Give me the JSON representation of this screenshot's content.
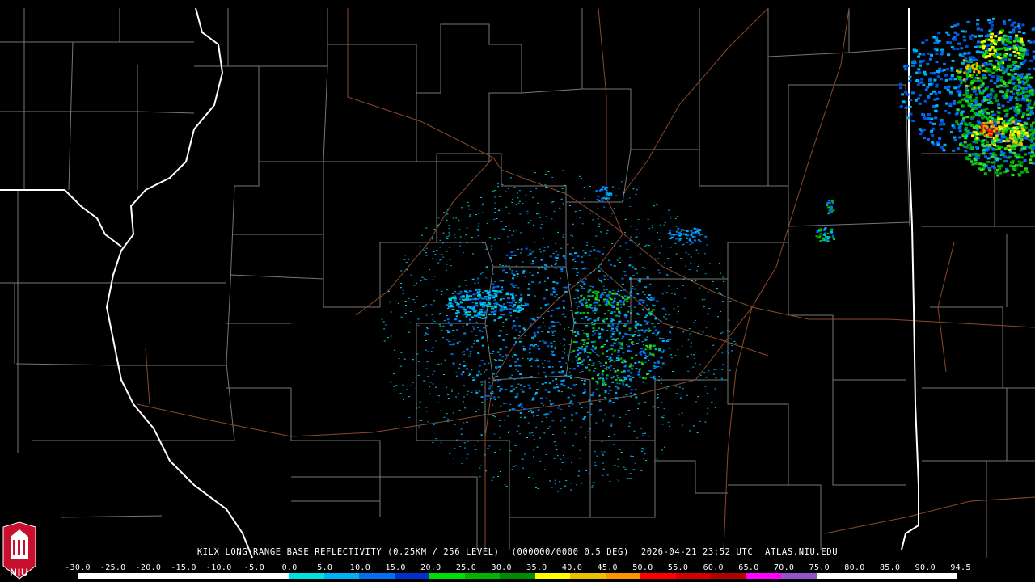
{
  "map": {
    "caption_parts": [
      "KILX LONG RANGE BASE REFLECTIVITY (0.25KM / 256 LEVEL)",
      "(000000/0000 0.5 DEG)",
      "2026-04-21 23:52 UTC",
      "ATLAS.NIU.EDU"
    ],
    "logo_text": "NIU",
    "logo_icon": "university-seal-icon",
    "colors": {
      "background": "#000000",
      "county_borders": "#7a7a7a",
      "state_border": "#ffffff",
      "roads": "#8b4a2b"
    }
  },
  "legend": {
    "labels": [
      "-30.0",
      "-25.0",
      "-20.0",
      "-15.0",
      "-10.0",
      "-5.0",
      "0.0",
      "5.0",
      "10.0",
      "15.0",
      "20.0",
      "25.0",
      "30.0",
      "35.0",
      "40.0",
      "45.0",
      "50.0",
      "55.0",
      "60.0",
      "65.0",
      "70.0",
      "75.0",
      "80.0",
      "85.0",
      "90.0",
      "94.5"
    ],
    "colors": [
      "#ffffff",
      "#ffffff",
      "#ffffff",
      "#ffffff",
      "#ffffff",
      "#ffffff",
      "#00e0e0",
      "#00b0f0",
      "#0070f0",
      "#0030d0",
      "#00e000",
      "#00b400",
      "#008c00",
      "#ffff00",
      "#e8c000",
      "#ff9000",
      "#ff0000",
      "#d00000",
      "#b00000",
      "#ff00ff",
      "#9055c8",
      "#ffffff",
      "#ffffff",
      "#ffffff",
      "#ffffff"
    ]
  }
}
